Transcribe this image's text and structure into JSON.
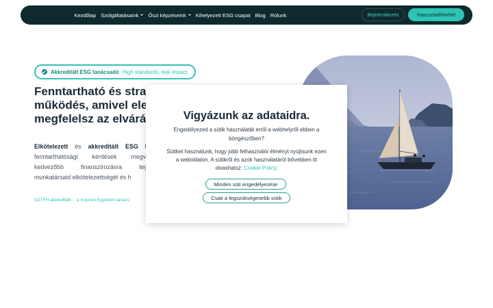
{
  "navbar": {
    "links": [
      {
        "label": "Kezdőlap",
        "dropdown": false
      },
      {
        "label": "Szolgáltatásaink",
        "dropdown": true
      },
      {
        "label": "Őszi képzéseink",
        "dropdown": true
      },
      {
        "label": "Kihelyezett ESG csapat",
        "dropdown": false
      },
      {
        "label": "Blog",
        "dropdown": false
      },
      {
        "label": "Rólunk",
        "dropdown": false
      }
    ],
    "login_label": "Bejelentkezés",
    "contact_label": "Kapcsolatfelvétel"
  },
  "hero": {
    "badge_strong": "Akkreditált ESG tanácsadó",
    "badge_soft": "High standards, real impact",
    "title_lines": [
      "Fenntartható és stra",
      "működés, amivel ele",
      "megfelelsz az elvárá"
    ],
    "text_strong1": "Elkötelezett",
    "text_mid1": " és ",
    "text_strong2": "akkreditált ESG tan",
    "text_rest": "fenntarthatósági kérdések megvála kedvezőbb finanszírozásra tegyé munkatársaid elkötelezettségét és h",
    "meta_1": "SZTFH-akkreditált",
    "meta_sep": "·",
    "meta_2": "a Soproni Egyetem tanács"
  },
  "cookie": {
    "title": "Vigyázunk az adataidra.",
    "question": "Engedélyezed a sütik használatát erről a webhelyről ebben a böngészőben?",
    "info": "Sütiket használunk, hogy jobb felhasználói élményt nyújtsunk ezen a weboldalon. A sütikről és azok használatáról bővebben itt olvashatsz:",
    "link_label": "Cookie Policy",
    "accept_all_label": "Minden süti engedélyezése",
    "essential_label": "Csak a legszükségesebb sütik"
  },
  "colors": {
    "nav_bg": "#0f2a2c",
    "accent": "#2ec4b6",
    "accent_dark": "#138a80",
    "text_dark": "#1b2a36"
  },
  "icons": {
    "badge": "check-circle-icon",
    "dropdown": "caret-down-icon"
  }
}
